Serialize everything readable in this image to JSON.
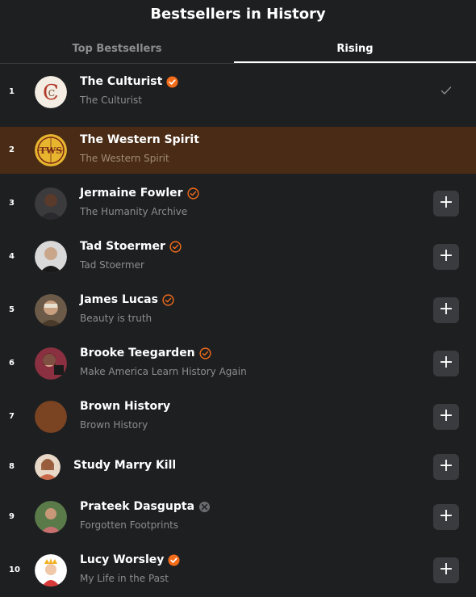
{
  "header": {
    "title": "Bestsellers in History"
  },
  "tabs": [
    {
      "label": "Top Bestsellers",
      "active": false
    },
    {
      "label": "Rising",
      "active": true
    }
  ],
  "colors": {
    "accent": "#f26c1a",
    "highlight_row": "#4a2c16",
    "button_bg": "#3a3b3e",
    "muted": "#8c8d90"
  },
  "list": [
    {
      "rank": "1",
      "name": "The Culturist",
      "subtitle": "The Culturist",
      "badge": "verified-filled",
      "action": "subscribed-check",
      "avatar": "culturist-logo"
    },
    {
      "rank": "2",
      "name": "The Western Spirit",
      "subtitle": "The Western Spirit",
      "badge": "none",
      "action": "none",
      "avatar": "tws-emblem"
    },
    {
      "rank": "3",
      "name": "Jermaine Fowler",
      "subtitle": "The Humanity Archive",
      "badge": "verified-outline",
      "action": "add",
      "avatar": "person-photo"
    },
    {
      "rank": "4",
      "name": "Tad Stoermer",
      "subtitle": "Tad Stoermer",
      "badge": "verified-outline",
      "action": "add",
      "avatar": "person-photo"
    },
    {
      "rank": "5",
      "name": "James Lucas",
      "subtitle": "Beauty is truth",
      "badge": "verified-outline",
      "action": "add",
      "avatar": "person-photo"
    },
    {
      "rank": "6",
      "name": "Brooke Teegarden",
      "subtitle": "Make America Learn History Again",
      "badge": "verified-outline",
      "action": "add",
      "avatar": "person-photo"
    },
    {
      "rank": "7",
      "name": "Brown History",
      "subtitle": "Brown History",
      "badge": "none",
      "action": "add",
      "avatar": "brown-circle"
    },
    {
      "rank": "8",
      "name": "Study Marry Kill",
      "subtitle": "",
      "badge": "none",
      "action": "add",
      "avatar": "person-photo"
    },
    {
      "rank": "9",
      "name": "Prateek Dasgupta",
      "subtitle": "Forgotten Footprints",
      "badge": "gray-badge",
      "action": "add",
      "avatar": "person-photo"
    },
    {
      "rank": "10",
      "name": "Lucy Worsley",
      "subtitle": "My Life in the Past",
      "badge": "verified-filled",
      "action": "add",
      "avatar": "queen-illustration"
    }
  ],
  "actions": {
    "add_glyph": "+"
  }
}
